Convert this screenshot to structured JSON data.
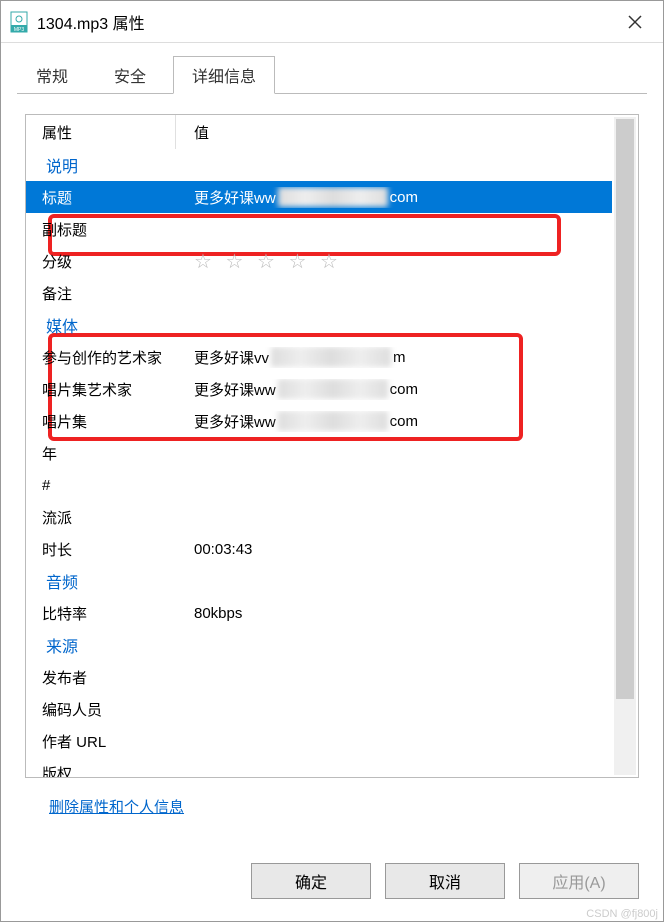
{
  "titlebar": {
    "title": "1304.mp3 属性"
  },
  "tabs": [
    {
      "label": "常规",
      "active": false
    },
    {
      "label": "安全",
      "active": false
    },
    {
      "label": "详细信息",
      "active": true
    }
  ],
  "header": {
    "prop": "属性",
    "val": "值"
  },
  "groups": {
    "desc": {
      "label": "说明",
      "rows": [
        {
          "k": "标题",
          "v_prefix": "更多好课ww",
          "v_suffix": "com",
          "censored": true,
          "selected": true
        },
        {
          "k": "副标题",
          "v": ""
        },
        {
          "k": "分级",
          "stars": true
        },
        {
          "k": "备注",
          "v": ""
        }
      ]
    },
    "media": {
      "label": "媒体",
      "rows": [
        {
          "k": "参与创作的艺术家",
          "v_prefix": "更多好课vv",
          "v_suffix": "m",
          "censored": true
        },
        {
          "k": "唱片集艺术家",
          "v_prefix": "更多好课ww",
          "v_suffix": "com",
          "censored": true
        },
        {
          "k": "唱片集",
          "v_prefix": "更多好课ww",
          "v_suffix": "com",
          "censored": true
        },
        {
          "k": "年",
          "v": ""
        },
        {
          "k": "#",
          "v": ""
        },
        {
          "k": "流派",
          "v": ""
        },
        {
          "k": "时长",
          "v": "00:03:43"
        }
      ]
    },
    "audio": {
      "label": "音频",
      "rows": [
        {
          "k": "比特率",
          "v": "80kbps"
        }
      ]
    },
    "origin": {
      "label": "来源",
      "rows": [
        {
          "k": "发布者",
          "v": ""
        },
        {
          "k": "编码人员",
          "v": ""
        },
        {
          "k": "作者 URL",
          "v": ""
        },
        {
          "k": "版权",
          "v": ""
        }
      ]
    }
  },
  "link_delete": "删除属性和个人信息",
  "buttons": {
    "ok": "确定",
    "cancel": "取消",
    "apply": "应用(A)"
  },
  "watermark": "CSDN @fj800j",
  "star_glyph": "☆ ☆ ☆ ☆ ☆"
}
